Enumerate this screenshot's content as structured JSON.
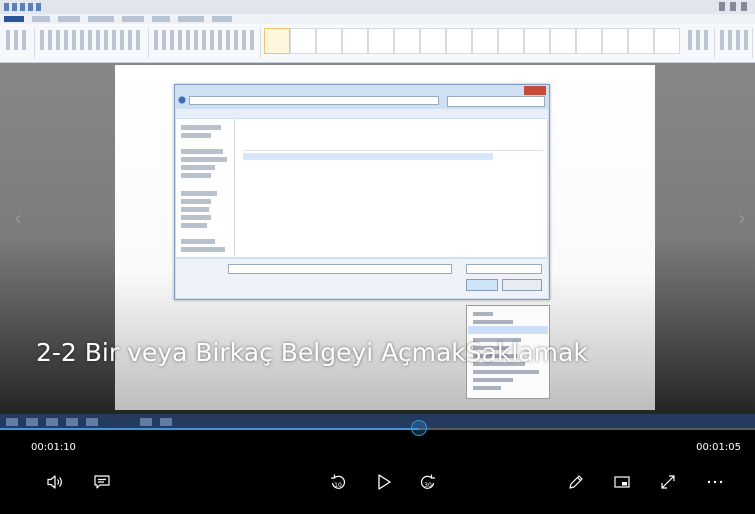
{
  "video": {
    "caption": "2-2 Bir veya Birkaç Belgeyi AçmakSaklamak"
  },
  "player": {
    "current_time": "00:01:10",
    "total_time": "00:01:05",
    "progress": 0.555,
    "accent_color": "#3a96dd",
    "controls": {
      "volume": "volume-icon",
      "captions": "captions-icon",
      "skip_back": "skip-back-10-icon",
      "play": "play-icon",
      "skip_forward": "skip-forward-30-icon",
      "edit": "pen-icon",
      "mini_view": "mini-view-icon",
      "fullscreen": "fullscreen-icon",
      "more": "more-icon"
    }
  }
}
